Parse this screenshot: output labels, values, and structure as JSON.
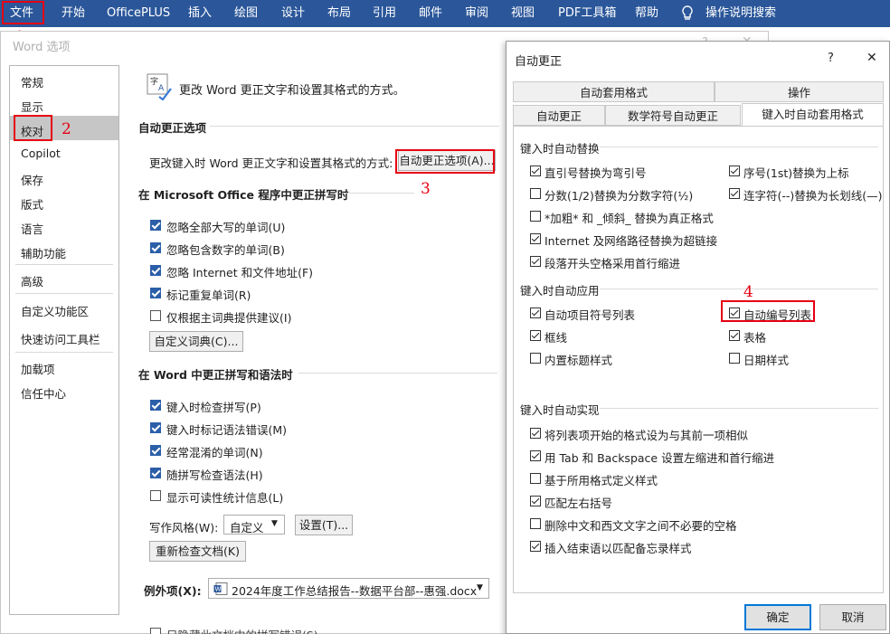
{
  "ribbon": {
    "tabs": [
      "文件",
      "开始",
      "OfficePLUS",
      "插入",
      "绘图",
      "设计",
      "布局",
      "引用",
      "邮件",
      "审阅",
      "视图",
      "PDF工具箱",
      "帮助"
    ],
    "search": "操作说明搜索",
    "bg_color": "#2b579a"
  },
  "annotations": {
    "n1": "1",
    "n2": "2",
    "n3": "3",
    "n4": "4",
    "color": "#e60012"
  },
  "options": {
    "title": "Word 选项",
    "nav": [
      "常规",
      "显示",
      "校对",
      "Copilot",
      "保存",
      "版式",
      "语言",
      "辅助功能",
      "高级",
      "自定义功能区",
      "快速访问工具栏",
      "加载项",
      "信任中心"
    ],
    "intro": "更改 Word 更正文字和设置其格式的方式。",
    "autocorrect_section": "自动更正选项",
    "autocorrect_desc": "更改键入时 Word 更正文字和设置其格式的方式:",
    "autocorrect_button": "自动更正选项(A)...",
    "office_section": "在 Microsoft Office 程序中更正拼写时",
    "office_items": [
      {
        "label": "忽略全部大写的单词(U)",
        "checked": true
      },
      {
        "label": "忽略包含数字的单词(B)",
        "checked": true
      },
      {
        "label": "忽略 Internet 和文件地址(F)",
        "checked": true
      },
      {
        "label": "标记重复单词(R)",
        "checked": true
      },
      {
        "label": "仅根据主词典提供建议(I)",
        "checked": false
      }
    ],
    "custom_dict_button": "自定义词典(C)...",
    "word_section": "在 Word 中更正拼写和语法时",
    "word_items": [
      {
        "label": "键入时检查拼写(P)",
        "checked": true
      },
      {
        "label": "键入时标记语法错误(M)",
        "checked": true
      },
      {
        "label": "经常混淆的单词(N)",
        "checked": true
      },
      {
        "label": "随拼写检查语法(H)",
        "checked": true
      },
      {
        "label": "显示可读性统计信息(L)",
        "checked": false
      }
    ],
    "writing_style_label": "写作风格(W):",
    "writing_style_value": "自定义",
    "settings_button": "设置(T)...",
    "recheck_button": "重新检查文档(K)",
    "exceptions_label": "例外项(X):",
    "exceptions_file": "2024年度工作总结报告--数据平台部--惠强.docx",
    "cut_item": "只隐藏此文档中的拼写错误(S)"
  },
  "dialog": {
    "title": "自动更正",
    "help": "?",
    "close": "✕",
    "tabs_row1": [
      "自动套用格式",
      "操作"
    ],
    "tabs_row2": [
      "自动更正",
      "数学符号自动更正",
      "键入时自动套用格式"
    ],
    "group1": "键入时自动替换",
    "replace_left": [
      {
        "label": "直引号替换为弯引号",
        "checked": true
      },
      {
        "label": "分数(1/2)替换为分数字符(½)",
        "checked": false
      },
      {
        "label": "*加粗* 和 _倾斜_ 替换为真正格式",
        "checked": false
      },
      {
        "label": "Internet 及网络路径替换为超链接",
        "checked": true
      },
      {
        "label": "段落开头空格采用首行缩进",
        "checked": true
      }
    ],
    "replace_right": [
      {
        "label": "序号(1st)替换为上标",
        "checked": true
      },
      {
        "label": "连字符(--)替换为长划线(—)",
        "checked": true
      }
    ],
    "group2": "键入时自动应用",
    "apply_left": [
      {
        "label": "自动项目符号列表",
        "checked": true
      },
      {
        "label": "框线",
        "checked": true
      },
      {
        "label": "内置标题样式",
        "checked": false
      }
    ],
    "apply_right": [
      {
        "label": "自动编号列表",
        "checked": true
      },
      {
        "label": "表格",
        "checked": true
      },
      {
        "label": "日期样式",
        "checked": false
      }
    ],
    "group3": "键入时自动实现",
    "auto_items": [
      {
        "label": "将列表项开始的格式设为与其前一项相似",
        "checked": true
      },
      {
        "label": "用 Tab 和 Backspace 设置左缩进和首行缩进",
        "checked": true
      },
      {
        "label": "基于所用格式定义样式",
        "checked": false
      },
      {
        "label": "匹配左右括号",
        "checked": true
      },
      {
        "label": "删除中文和西文文字之间不必要的空格",
        "checked": false
      },
      {
        "label": "插入结束语以匹配备忘录样式",
        "checked": true
      }
    ],
    "ok": "确定",
    "cancel": "取消"
  }
}
